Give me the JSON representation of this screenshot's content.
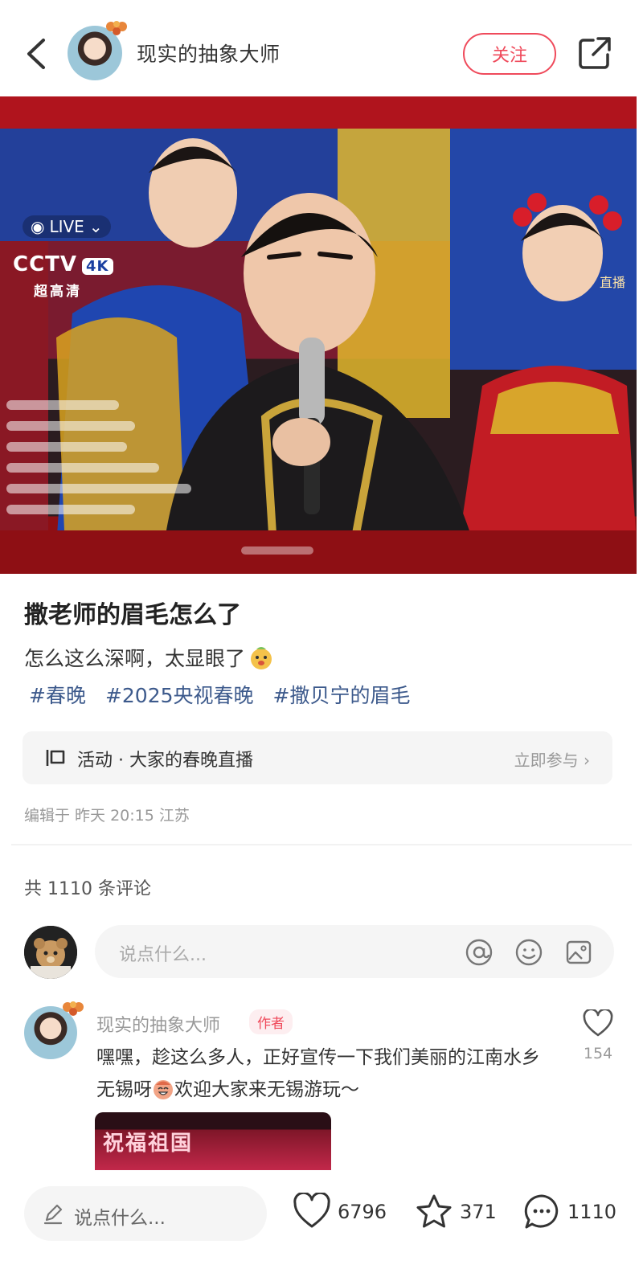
{
  "header": {
    "author_name": "现实的抽象大师",
    "follow_label": "关注"
  },
  "video": {
    "live_label": "LIVE",
    "channel_logo": "CCTV",
    "channel_quality": "4K",
    "channel_sub": "超高清",
    "live_badge": "直播"
  },
  "post": {
    "title": "撒老师的眉毛怎么了",
    "text": "怎么这么深啊，太显眼了",
    "tags": [
      "#春晚",
      "#2025央视春晚",
      "#撒贝宁的眉毛"
    ],
    "activity_label": "活动 · 大家的春晚直播",
    "activity_cta": "立即参与 ›",
    "edit_info": "编辑于 昨天 20:15 江苏"
  },
  "comments": {
    "count_label": "共 1110 条评论",
    "input_placeholder": "说点什么...",
    "first": {
      "author": "现实的抽象大师",
      "badge": "作者",
      "text_a": "嘿嘿，趁这么多人，正好宣传一下我们美丽的江南水乡无锡呀",
      "text_b": "欢迎大家来无锡游玩～",
      "likes": "154",
      "image_text": "祝福祖国"
    }
  },
  "bottom_bar": {
    "input_placeholder": "说点什么...",
    "likes": "6796",
    "stars": "371",
    "comments": "1110"
  },
  "colors": {
    "accent": "#ef4a5b",
    "tag": "#3d5a8c",
    "muted": "#999999"
  }
}
